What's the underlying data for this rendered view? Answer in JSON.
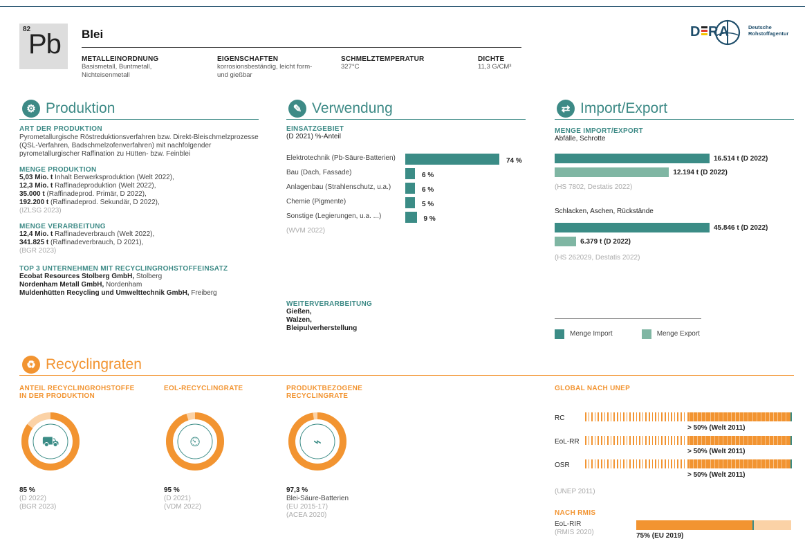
{
  "element": {
    "number": "82",
    "symbol": "Pb",
    "name": "Blei"
  },
  "props": [
    {
      "label": "METALLEINORDNUNG",
      "value": "Basismetall, Buntmetall, Nichteisenmetall"
    },
    {
      "label": "EIGENSCHAFTEN",
      "value": "korrosionsbeständig, leicht form- und gießbar"
    },
    {
      "label": "SCHMELZTEMPERATUR",
      "value": "327°C"
    },
    {
      "label": "DICHTE",
      "value": "11,3 G/CM³"
    }
  ],
  "logo": {
    "text": "DERA",
    "line1": "Deutsche",
    "line2": "Rohstoffagentur"
  },
  "produktion": {
    "title": "Produktion",
    "art_h": "ART DER PRODUKTION",
    "art_text": "Pyrometallurgische Röstreduktionsverfahren bzw. Direkt-Bleischmelzprozesse (QSL-Verfahren, Badschmelzofenverfahren) mit nachfolgender pyrometallurgischer Raffination zu Hütten- bzw. Feinblei",
    "menge_h": "MENGE PRODUKTION",
    "menge": [
      {
        "b": "5,03 Mio. t",
        "r": " Inhalt Berwerksproduktion (Welt 2022),"
      },
      {
        "b": "12,3 Mio. t",
        "r": " Raffinadeproduktion (Welt 2022),"
      },
      {
        "b": "35.000 t",
        "r": " (Raffinadeprod. Primär, D 2022),"
      },
      {
        "b": "192.200 t",
        "r": " (Raffinadeprod. Sekundär, D 2022),"
      }
    ],
    "menge_src": "(IZLSG 2023)",
    "verarb_h": "MENGE VERARBEITUNG",
    "verarb": [
      {
        "b": "12,4 Mio. t",
        "r": " Raffinadeverbrauch (Welt 2022),"
      },
      {
        "b": "341.825 t",
        "r": " (Raffinadeverbrauch, D 2021),"
      }
    ],
    "verarb_src": "(BGR 2023)",
    "top_h": "TOP 3 UNTERNEHMEN MIT RECYCLINGROHSTOFFEINSATZ",
    "top": [
      {
        "b": "Ecobat Resources Stolberg GmbH,",
        "r": " Stolberg"
      },
      {
        "b": "Nordenham Metall GmbH,",
        "r": " Nordenham"
      },
      {
        "b": "Muldenhütten Recycling und Umwelttechnik GmbH,",
        "r": " Freiberg"
      }
    ]
  },
  "verwendung": {
    "title": "Verwendung",
    "h": "EINSATZGEBIET",
    "sub": "(D 2021) %-Anteil",
    "src": "(WVM 2022)",
    "weiter_h": "WEITERVERARBEITUNG",
    "weiter": [
      "Gießen,",
      "Walzen,",
      "Bleipulverherstellung"
    ]
  },
  "chart_data": [
    {
      "type": "bar",
      "title": "EINSATZGEBIET",
      "subtitle": "(D 2021) %-Anteil",
      "categories": [
        "Elektrotechnik (Pb-Säure-Batterien)",
        "Bau (Dach, Fassade)",
        "Anlagenbau (Strahlenschutz, u.a.)",
        "Chemie (Pigmente)",
        "Sonstige (Legierungen, u.a. ...)"
      ],
      "values": [
        74,
        6,
        6,
        5,
        9
      ],
      "labels": [
        "74 %",
        "6 %",
        "6 %",
        "5 %",
        "9 %"
      ]
    },
    {
      "type": "bar",
      "title": "Abfälle, Schrotte",
      "categories": [
        "Menge Import",
        "Menge Export"
      ],
      "values": [
        16514,
        12194
      ],
      "labels": [
        "16.514 t (D 2022)",
        "12.194 t (D 2022)"
      ]
    },
    {
      "type": "bar",
      "title": "Schlacken, Aschen, Rückstände",
      "categories": [
        "Menge Import",
        "Menge Export"
      ],
      "values": [
        45846,
        6379
      ],
      "labels": [
        "45.846 t (D 2022)",
        "6.379 t (D 2022)"
      ]
    },
    {
      "type": "pie",
      "title": "ANTEIL RECYCLINGROHSTOFFE IN DER PRODUKTION",
      "values": [
        85,
        15
      ]
    },
    {
      "type": "pie",
      "title": "EOL-RECYCLINGRATE",
      "values": [
        95,
        5
      ]
    },
    {
      "type": "pie",
      "title": "PRODUKTBEZOGENE RECYCLINGRATE",
      "values": [
        97.3,
        2.7
      ]
    },
    {
      "type": "bar",
      "title": "NACH RMIS",
      "categories": [
        "EoL-RIR"
      ],
      "values": [
        75
      ],
      "labels": [
        "75% (EU 2019)"
      ]
    }
  ],
  "import": {
    "title": "Import/Export",
    "h": "MENGE IMPORT/EXPORT",
    "g1": "Abfälle, Schrotte",
    "src1": "(HS 7802, Destatis 2022)",
    "g2": "Schlacken, Aschen, Rückstände",
    "src2": "(HS 262029, Destatis 2022)",
    "legend_import": "Menge Import",
    "legend_export": "Menge Export"
  },
  "recycling": {
    "title": "Recyclingraten",
    "c1_h1": "ANTEIL RECYCLINGROHSTOFFE",
    "c1_h2": "IN DER PRODUKTION",
    "c1_val": "85 %",
    "c1_s1": "(D 2022)",
    "c1_s2": "(BGR 2023)",
    "c2_h": "EOL-RECYCLINGRATE",
    "c2_val": "95 %",
    "c2_s1": "(D 2021)",
    "c2_s2": "(VDM 2022)",
    "c3_h1": "PRODUKTBEZOGENE",
    "c3_h2": "RECYCLINGRATE",
    "c3_val": "97,3 %",
    "c3_s0": "Blei-Säure-Batterien",
    "c3_s1": "(EU 2015-17)",
    "c3_s2": "(ACEA 2020)"
  },
  "unep": {
    "h": "GLOBAL NACH UNEP",
    "rows": [
      {
        "label": "RC",
        "val": "> 50% (Welt 2011)"
      },
      {
        "label": "EoL-RR",
        "val": "> 50% (Welt 2011)"
      },
      {
        "label": "OSR",
        "val": "> 50% (Welt 2011)"
      }
    ],
    "src": "(UNEP 2011)",
    "rmis_h": "NACH RMIS",
    "rmis_label": "EoL-RIR",
    "rmis_src": "(RMIS 2020)"
  },
  "colors": {
    "teal": "#3b8c86",
    "light_teal": "#7fb6a3",
    "orange": "#f29431",
    "light_orange": "#fbd2a6",
    "navy": "#1f4e6b"
  }
}
